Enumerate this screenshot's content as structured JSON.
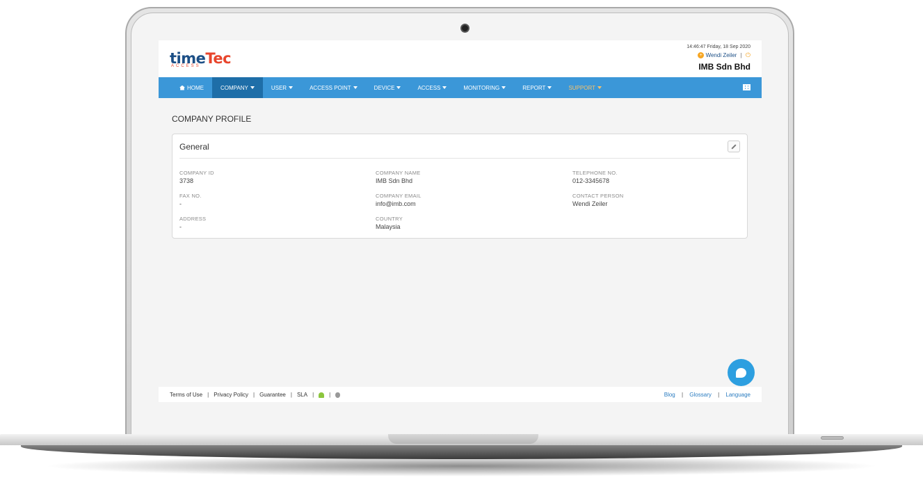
{
  "header": {
    "logo_time": "time",
    "logo_tec": "Tec",
    "logo_sub": "ACCESS",
    "datetime": "14:46:47 Friday, 18 Sep 2020",
    "user_name": "Wendi Zeiler",
    "separator": "|",
    "company_name": "IMB Sdn Bhd"
  },
  "nav": {
    "items": [
      {
        "label": "HOME",
        "icon": "home-icon"
      },
      {
        "label": "COMPANY",
        "active": true
      },
      {
        "label": "USER"
      },
      {
        "label": "ACCESS POINT"
      },
      {
        "label": "DEVICE"
      },
      {
        "label": "ACCESS"
      },
      {
        "label": "MONITORING"
      },
      {
        "label": "REPORT"
      },
      {
        "label": "SUPPORT"
      }
    ],
    "apps_icon": "grid-icon"
  },
  "main": {
    "page_title": "COMPANY PROFILE",
    "card": {
      "title": "General",
      "edit_icon": "pencil-icon",
      "fields": [
        {
          "label": "COMPANY ID",
          "value": "3738"
        },
        {
          "label": "COMPANY NAME",
          "value": "IMB Sdn Bhd"
        },
        {
          "label": "TELEPHONE NO.",
          "value": "012-3345678"
        },
        {
          "label": "FAX NO.",
          "value": "-"
        },
        {
          "label": "COMPANY EMAIL",
          "value": "info@imb.com"
        },
        {
          "label": "CONTACT PERSON",
          "value": "Wendi Zeiler"
        },
        {
          "label": "ADDRESS",
          "value": "-"
        },
        {
          "label": "COUNTRY",
          "value": "Malaysia"
        }
      ]
    }
  },
  "footer": {
    "left_links": [
      "Terms of Use",
      "Privacy Policy",
      "Guarantee",
      "SLA"
    ],
    "right_links": [
      "Blog",
      "Glossary",
      "Language"
    ],
    "separator": "|"
  },
  "colors": {
    "nav_bg": "#3b97d8",
    "nav_active": "#1e6ea8",
    "support_text": "#f6c26b",
    "link": "#2a7cc0",
    "chat": "#2d9fe0"
  }
}
